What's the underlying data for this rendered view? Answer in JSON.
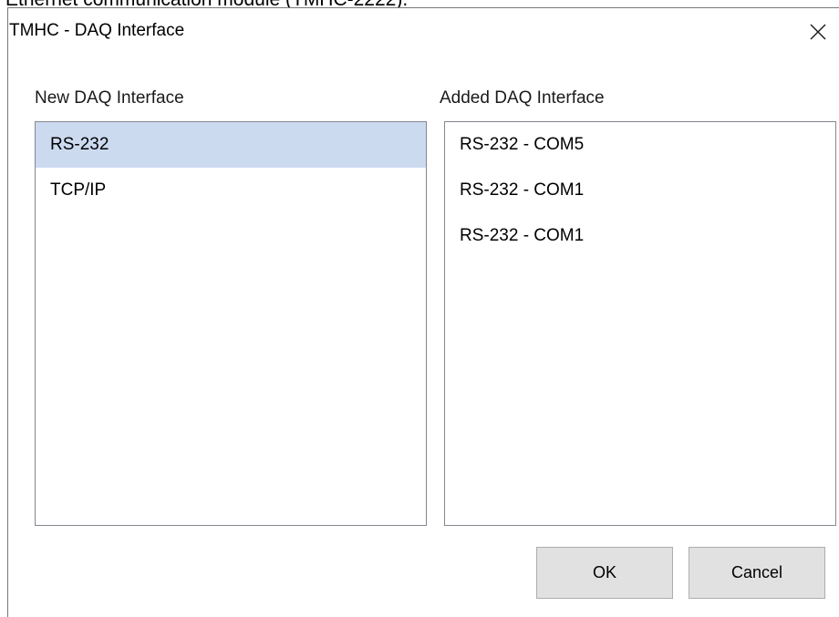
{
  "caption": "Ethernet communication module (TMHC-2222).",
  "dialog": {
    "title": "TMHC - DAQ Interface",
    "close_icon": "close-icon"
  },
  "new_interface": {
    "label": "New DAQ Interface",
    "items": [
      {
        "label": "RS-232",
        "selected": true
      },
      {
        "label": "TCP/IP",
        "selected": false
      }
    ]
  },
  "added_interface": {
    "label": "Added DAQ Interface",
    "items": [
      {
        "label": "RS-232 - COM5"
      },
      {
        "label": "RS-232 - COM1"
      },
      {
        "label": "RS-232 - COM1"
      }
    ]
  },
  "buttons": {
    "ok_label": "OK",
    "cancel_label": "Cancel"
  },
  "colors": {
    "selection": "#ccdaf0",
    "button_face": "#e1e1e1",
    "list_border": "#828790"
  }
}
